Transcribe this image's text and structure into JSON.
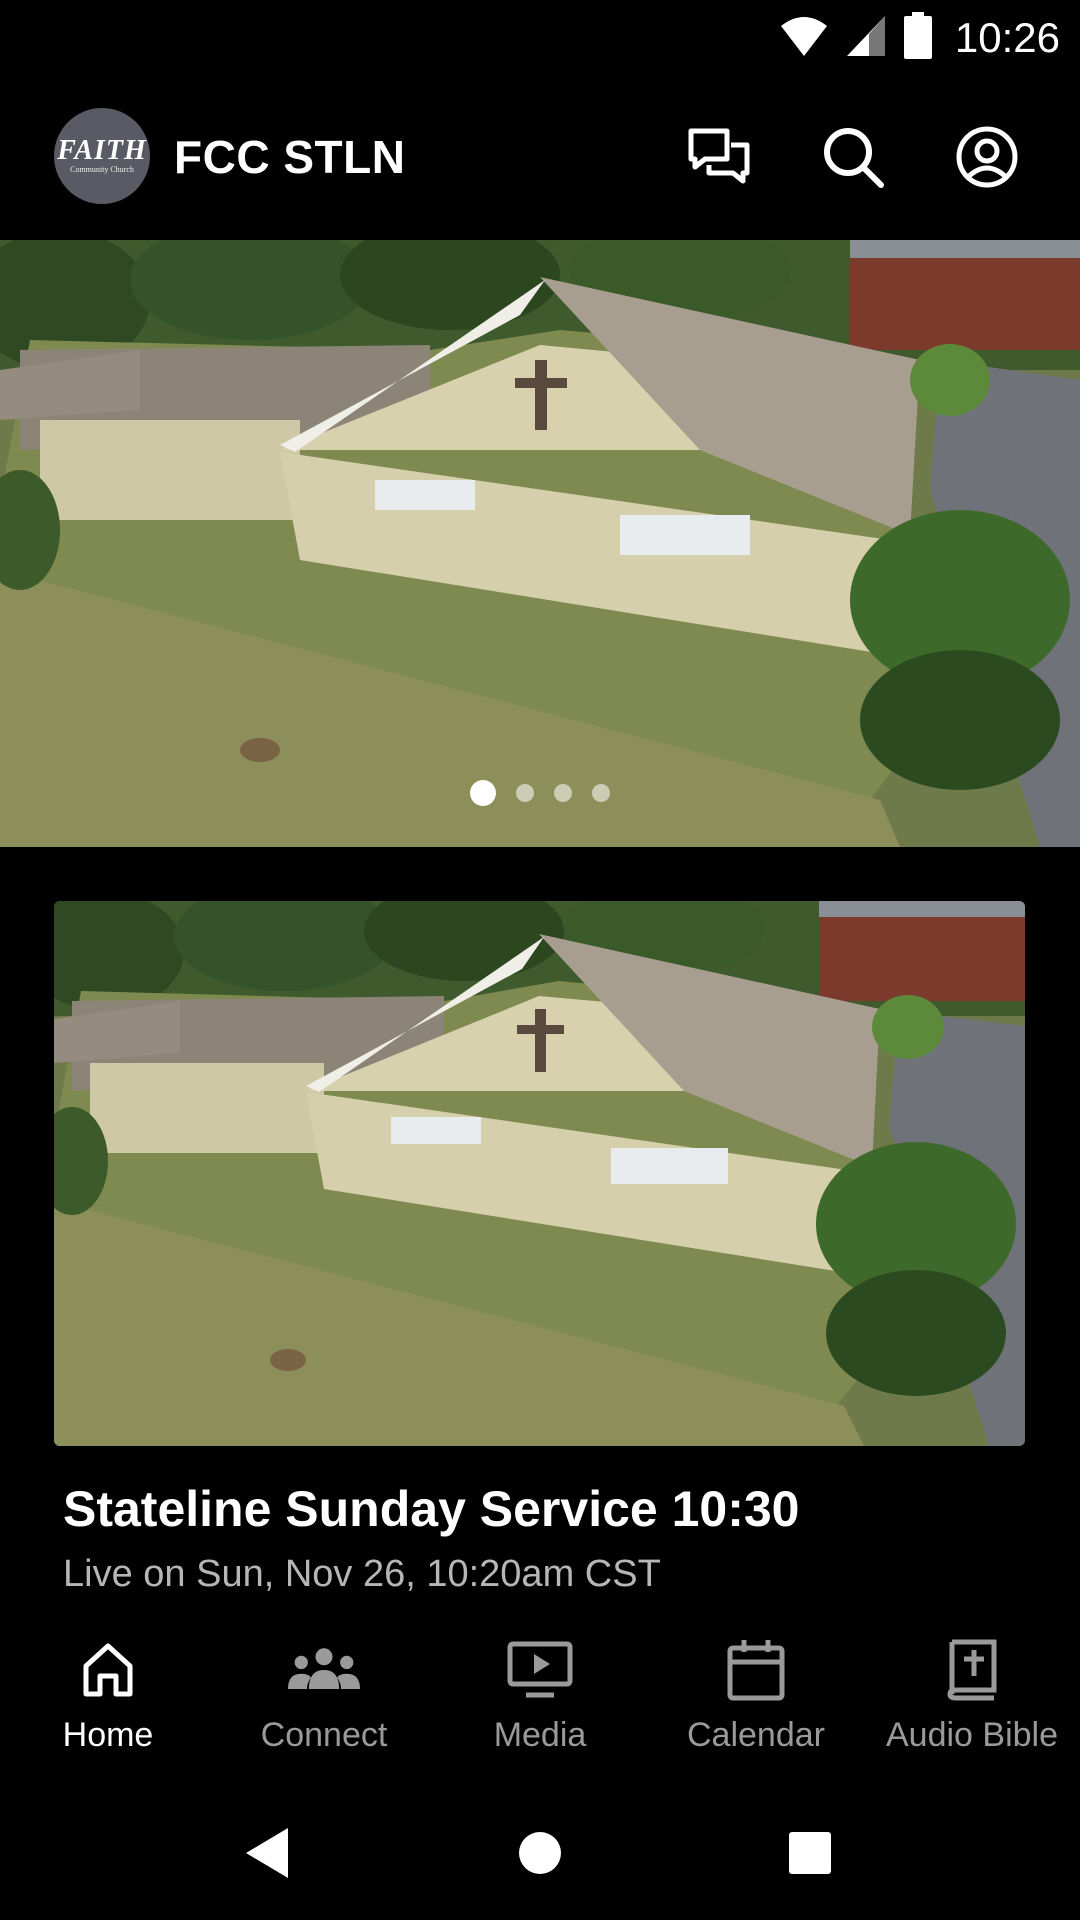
{
  "status_bar": {
    "time": "10:26",
    "icons": [
      "wifi-icon",
      "cell-signal-icon",
      "battery-icon"
    ]
  },
  "app_bar": {
    "logo_text_main": "FAITH",
    "logo_text_sub": "Community Church",
    "title": "FCC STLN",
    "actions": [
      "chat-icon",
      "search-icon",
      "account-icon"
    ]
  },
  "hero": {
    "image": "church-aerial-photo",
    "carousel_pages": 4,
    "active_page": 1
  },
  "featured": {
    "image": "church-aerial-photo",
    "title": "Stateline Sunday Service 10:30",
    "subtitle": "Live on Sun, Nov 26, 10:20am CST"
  },
  "bottom_nav": [
    {
      "label": "Home",
      "icon": "home-icon",
      "active": true
    },
    {
      "label": "Connect",
      "icon": "group-icon",
      "active": false
    },
    {
      "label": "Media",
      "icon": "tv-play-icon",
      "active": false
    },
    {
      "label": "Calendar",
      "icon": "calendar-icon",
      "active": false
    },
    {
      "label": "Audio Bible",
      "icon": "bible-icon",
      "active": false
    }
  ],
  "colors": {
    "background": "#000000",
    "text_primary": "#ffffff",
    "text_secondary": "#b6b6b6",
    "nav_inactive": "#9a9a9a"
  }
}
